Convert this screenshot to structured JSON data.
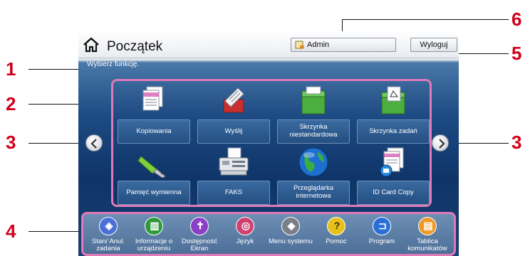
{
  "callouts": [
    "1",
    "2",
    "3",
    "3",
    "4",
    "5",
    "6"
  ],
  "header": {
    "title": "Początek",
    "admin_label": "Admin",
    "logout_label": "Wyloguj"
  },
  "instruction": "Wybierz funkcję.",
  "functions": [
    {
      "label": "Kopiowania",
      "icon": "copy-icon"
    },
    {
      "label": "Wyślij",
      "icon": "send-icon"
    },
    {
      "label": "Skrzynka niestandardowa",
      "icon": "custom-box-icon"
    },
    {
      "label": "Skrzynka zadań",
      "icon": "job-box-icon"
    },
    {
      "label": "Pamięć wymienna",
      "icon": "usb-memory-icon"
    },
    {
      "label": "FAKS",
      "icon": "fax-icon"
    },
    {
      "label": "Przeglądarka internetowa",
      "icon": "globe-icon"
    },
    {
      "label": "ID Card Copy",
      "icon": "id-card-copy-icon"
    }
  ],
  "bottom_bar": [
    {
      "label": "Stan/ Anul. zadania",
      "color": "#4a6fd6",
      "glyph": "◈"
    },
    {
      "label": "Informacje o urządzeniu",
      "color": "#2f9a3a",
      "glyph": "▥"
    },
    {
      "label": "Dostępność Ekran",
      "color": "#8a3fc4",
      "glyph": "✝"
    },
    {
      "label": "Język",
      "color": "#d04070",
      "glyph": "◎"
    },
    {
      "label": "Menu systemu",
      "color": "#7b7f88",
      "glyph": "◆"
    },
    {
      "label": "Pomoc",
      "color": "#e7c01a",
      "glyph": "?"
    },
    {
      "label": "Program",
      "color": "#2a6fd6",
      "glyph": "⊐"
    },
    {
      "label": "Tablica komunikatów",
      "color": "#ee9a2a",
      "glyph": "▤"
    }
  ]
}
